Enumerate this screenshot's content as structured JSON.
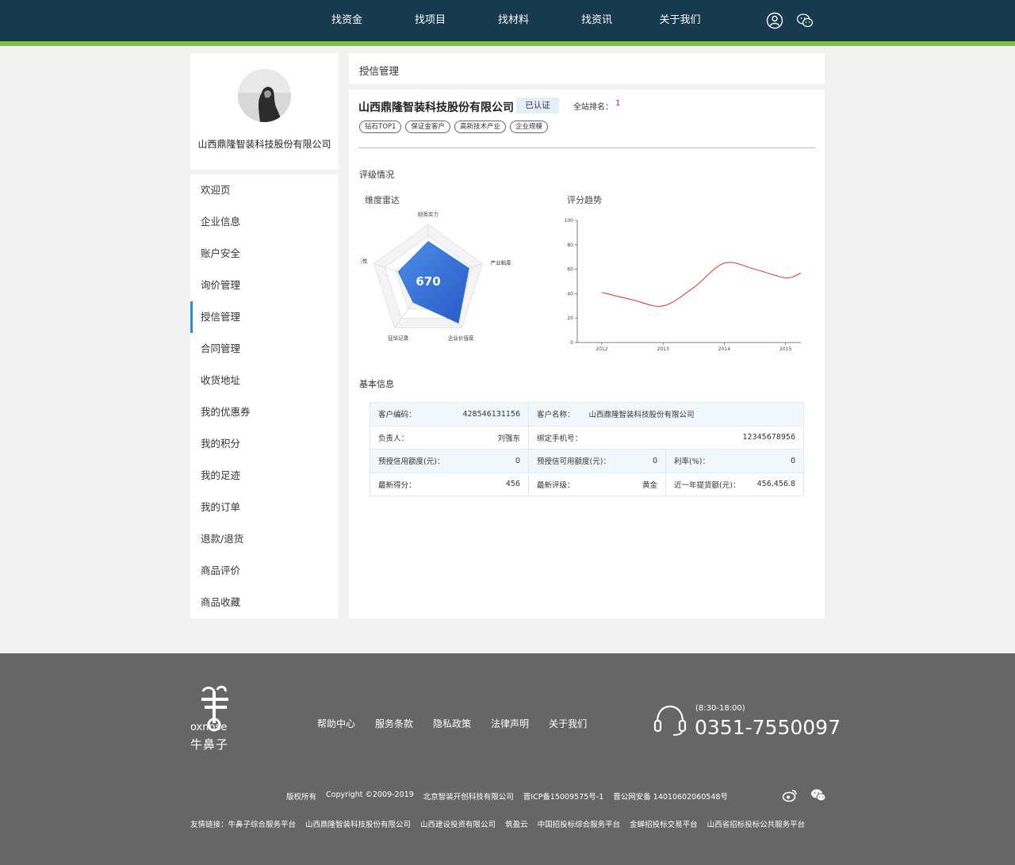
{
  "nav": {
    "items": [
      "找资金",
      "找项目",
      "找材料",
      "找资讯",
      "关于我们"
    ],
    "icons": [
      "user-icon",
      "wechat-icon"
    ]
  },
  "sidebar": {
    "company_name": "山西鼎隆智装科技股份有限公司",
    "menu": [
      "欢迎页",
      "企业信息",
      "账户安全",
      "询价管理",
      "授信管理",
      "合同管理",
      "收货地址",
      "我的优惠券",
      "我的积分",
      "我的足迹",
      "我的订单",
      "退款/退货",
      "商品评价",
      "商品收藏"
    ],
    "active_index": 4,
    "accent": "#2c8fd6"
  },
  "main": {
    "header_title": "授信管理",
    "company_title": "山西鼎隆智装科技股份有限公司",
    "verified": "已认证",
    "rank_label": "全站排名：",
    "rank_value": "1",
    "tags": [
      "钻石TOP1",
      "保证金客户",
      "高新技术产业",
      "企业规模"
    ],
    "rating_section": "评级情况",
    "basic_section": "基本信息"
  },
  "chart_data": [
    {
      "type": "radar",
      "title": "维度雷达",
      "center_value": "670",
      "axes": [
        "财务实力",
        "产业粘度",
        "企业价值度",
        "征信记录",
        "成长性"
      ],
      "values": [
        0.7,
        0.75,
        0.9,
        0.45,
        0.55
      ],
      "color": "#3a78d8"
    },
    {
      "type": "line",
      "title": "评分趋势",
      "x": [
        2012,
        2012.5,
        2013,
        2013.5,
        2014,
        2014.5,
        2015,
        2015.25
      ],
      "y": [
        41,
        35,
        30,
        45,
        65,
        60,
        53,
        57
      ],
      "xticks": [
        "2012",
        "2013",
        "2014",
        "2015"
      ],
      "yticks": [
        "0",
        "20",
        "40",
        "60",
        "80",
        "100"
      ],
      "ylim": [
        0,
        100
      ],
      "color": "#e0423a"
    }
  ],
  "info": {
    "rows": [
      [
        {
          "label": "客户编码：",
          "value": "428546131156"
        },
        {
          "label": "客户名称：",
          "value": "山西鼎隆智装科技股份有限公司"
        }
      ],
      [
        {
          "label": "负责人：",
          "value": "刘强东"
        },
        {
          "label": "绑定手机号：",
          "value": "12345678956"
        }
      ],
      [
        {
          "label": "预授信用额度(元)：",
          "value": "0"
        },
        {
          "label": "预授信可用额度(元)：",
          "value": "0"
        },
        {
          "label": "利率(%)：",
          "value": "0"
        }
      ],
      [
        {
          "label": "最新得分：",
          "value": "456"
        },
        {
          "label": "最新评级：",
          "value": "黄金"
        },
        {
          "label": "近一年提货额(元)：",
          "value": "456,456.8"
        }
      ]
    ]
  },
  "footer": {
    "logo_text": "牛鼻子",
    "logo_sub": "oxnose",
    "links": [
      "帮助中心",
      "服务条款",
      "隐私政策",
      "法律声明",
      "关于我们"
    ],
    "hours": "(8:30-18:00)",
    "phone": "0351-7550097",
    "copyright": [
      "版权所有",
      "Copyright ©2009-2019",
      "北京智装开创科技有限公司",
      "晋ICP备15009575号-1",
      "晋公网安备 14010602060548号"
    ],
    "friend_label": "友情链接：",
    "friend_links": [
      "牛鼻子综合服务平台",
      "山西鼎隆智装科技股份有限公司",
      "山西建设投资有限公司",
      "筑盈云",
      "中国招投标综合服务平台",
      "金蝉招投标交易平台",
      "山西省招标投标公共服务平台"
    ]
  }
}
